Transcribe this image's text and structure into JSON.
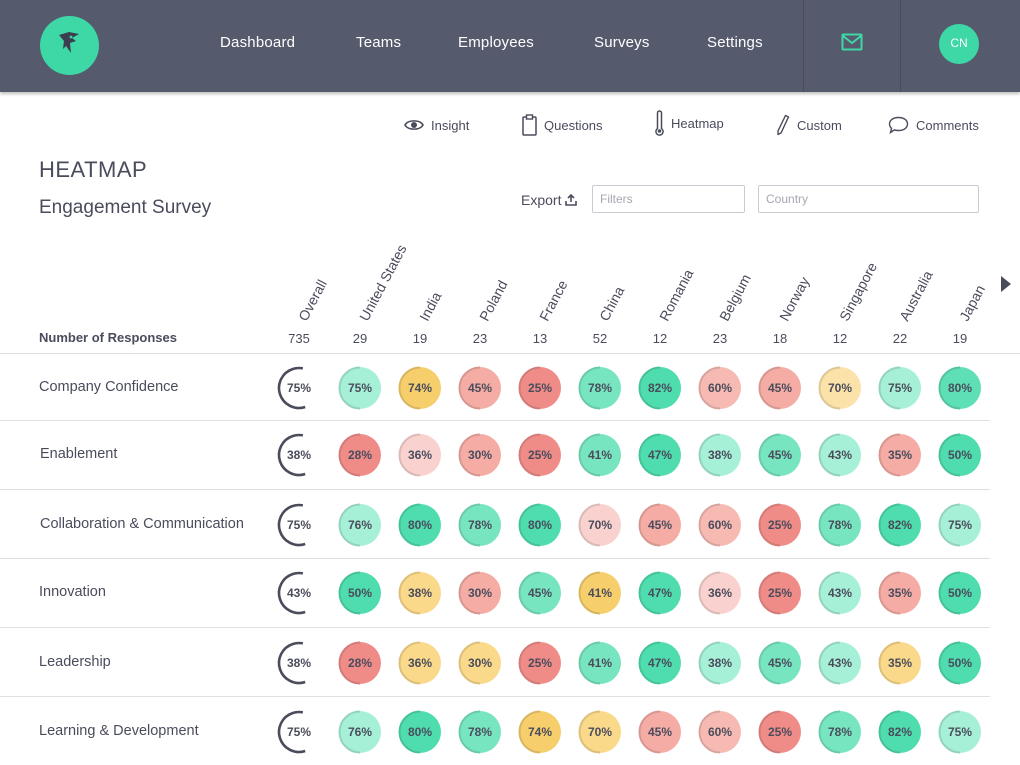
{
  "nav": {
    "items": [
      "Dashboard",
      "Teams",
      "Employees",
      "Surveys",
      "Settings"
    ],
    "avatar_initials": "CN",
    "logo_icon": "bird-head-icon",
    "mail_icon": "mail-icon"
  },
  "tabs": [
    {
      "label": "Insight",
      "icon": "eye-icon"
    },
    {
      "label": "Questions",
      "icon": "clipboard-icon"
    },
    {
      "label": "Heatmap",
      "icon": "thermometer-icon"
    },
    {
      "label": "Custom",
      "icon": "pencil-icon"
    },
    {
      "label": "Comments",
      "icon": "speech-bubble-icon"
    }
  ],
  "page": {
    "title": "HEATMAP",
    "subtitle": "Engagement Survey",
    "export_label": "Export",
    "filters_placeholder": "Filters",
    "country_placeholder": "Country"
  },
  "heatmap": {
    "columns": [
      "Overall",
      "United States",
      "India",
      "Poland",
      "France",
      "China",
      "Romania",
      "Belgium",
      "Norway",
      "Singapore",
      "Australia",
      "Japan"
    ],
    "responses_label": "Number of Responses",
    "responses": [
      735,
      29,
      19,
      23,
      13,
      52,
      12,
      23,
      18,
      12,
      22,
      19
    ],
    "rows": [
      {
        "label": "Company Confidence",
        "values": [
          75,
          75,
          74,
          45,
          25,
          78,
          82,
          60,
          45,
          70,
          75,
          80
        ]
      },
      {
        "label": "Enablement",
        "values": [
          38,
          28,
          36,
          30,
          25,
          41,
          47,
          38,
          45,
          43,
          35,
          50
        ]
      },
      {
        "label": "Collaboration & Communication",
        "values": [
          75,
          76,
          80,
          78,
          80,
          70,
          45,
          60,
          25,
          78,
          82,
          75
        ]
      },
      {
        "label": "Innovation",
        "values": [
          43,
          50,
          38,
          30,
          45,
          41,
          47,
          36,
          25,
          43,
          35,
          50
        ]
      },
      {
        "label": "Leadership",
        "values": [
          38,
          28,
          36,
          30,
          25,
          41,
          47,
          38,
          45,
          43,
          35,
          50
        ]
      },
      {
        "label": "Learning & Development",
        "values": [
          75,
          76,
          80,
          78,
          74,
          70,
          45,
          60,
          25,
          78,
          82,
          75
        ]
      }
    ],
    "cell_colors": [
      [
        "#a7f0d8",
        "#f6cf6c",
        "#f4aca4",
        "#ef8c88",
        "#78e5c1",
        "#4fdcae",
        "#f6bab3",
        "#f4aca4",
        "#fbe2a8",
        "#a7f0d8",
        "#5fdfb5"
      ],
      [
        "#ef8c88",
        "#f9d2cf",
        "#f4aca4",
        "#ef8c88",
        "#78e5c1",
        "#4fdcae",
        "#a7f0d8",
        "#78e5c1",
        "#a7f0d8",
        "#f4aca4",
        "#4fdcae"
      ],
      [
        "#a7f0d8",
        "#4fdcae",
        "#78e5c1",
        "#4fdcae",
        "#f9d2cf",
        "#f4aca4",
        "#f6bab3",
        "#ef8c88",
        "#78e5c1",
        "#4fdcae",
        "#a7f0d8"
      ],
      [
        "#4fdcae",
        "#fad98a",
        "#f4aca4",
        "#78e5c1",
        "#f6cf6c",
        "#4fdcae",
        "#f9d2cf",
        "#ef8c88",
        "#a7f0d8",
        "#f4aca4",
        "#4fdcae"
      ],
      [
        "#ef8c88",
        "#fad98a",
        "#fad98a",
        "#ef8c88",
        "#78e5c1",
        "#4fdcae",
        "#a7f0d8",
        "#78e5c1",
        "#a7f0d8",
        "#fad98a",
        "#4fdcae"
      ],
      [
        "#a7f0d8",
        "#4fdcae",
        "#78e5c1",
        "#f6cf6c",
        "#fad98a",
        "#f4aca4",
        "#f6bab3",
        "#ef8c88",
        "#78e5c1",
        "#4fdcae",
        "#a7f0d8"
      ]
    ],
    "colors": {
      "nav_bg": "#555a6c",
      "accent": "#3ed7a6",
      "overall_ring": "#4a4c5c"
    }
  }
}
